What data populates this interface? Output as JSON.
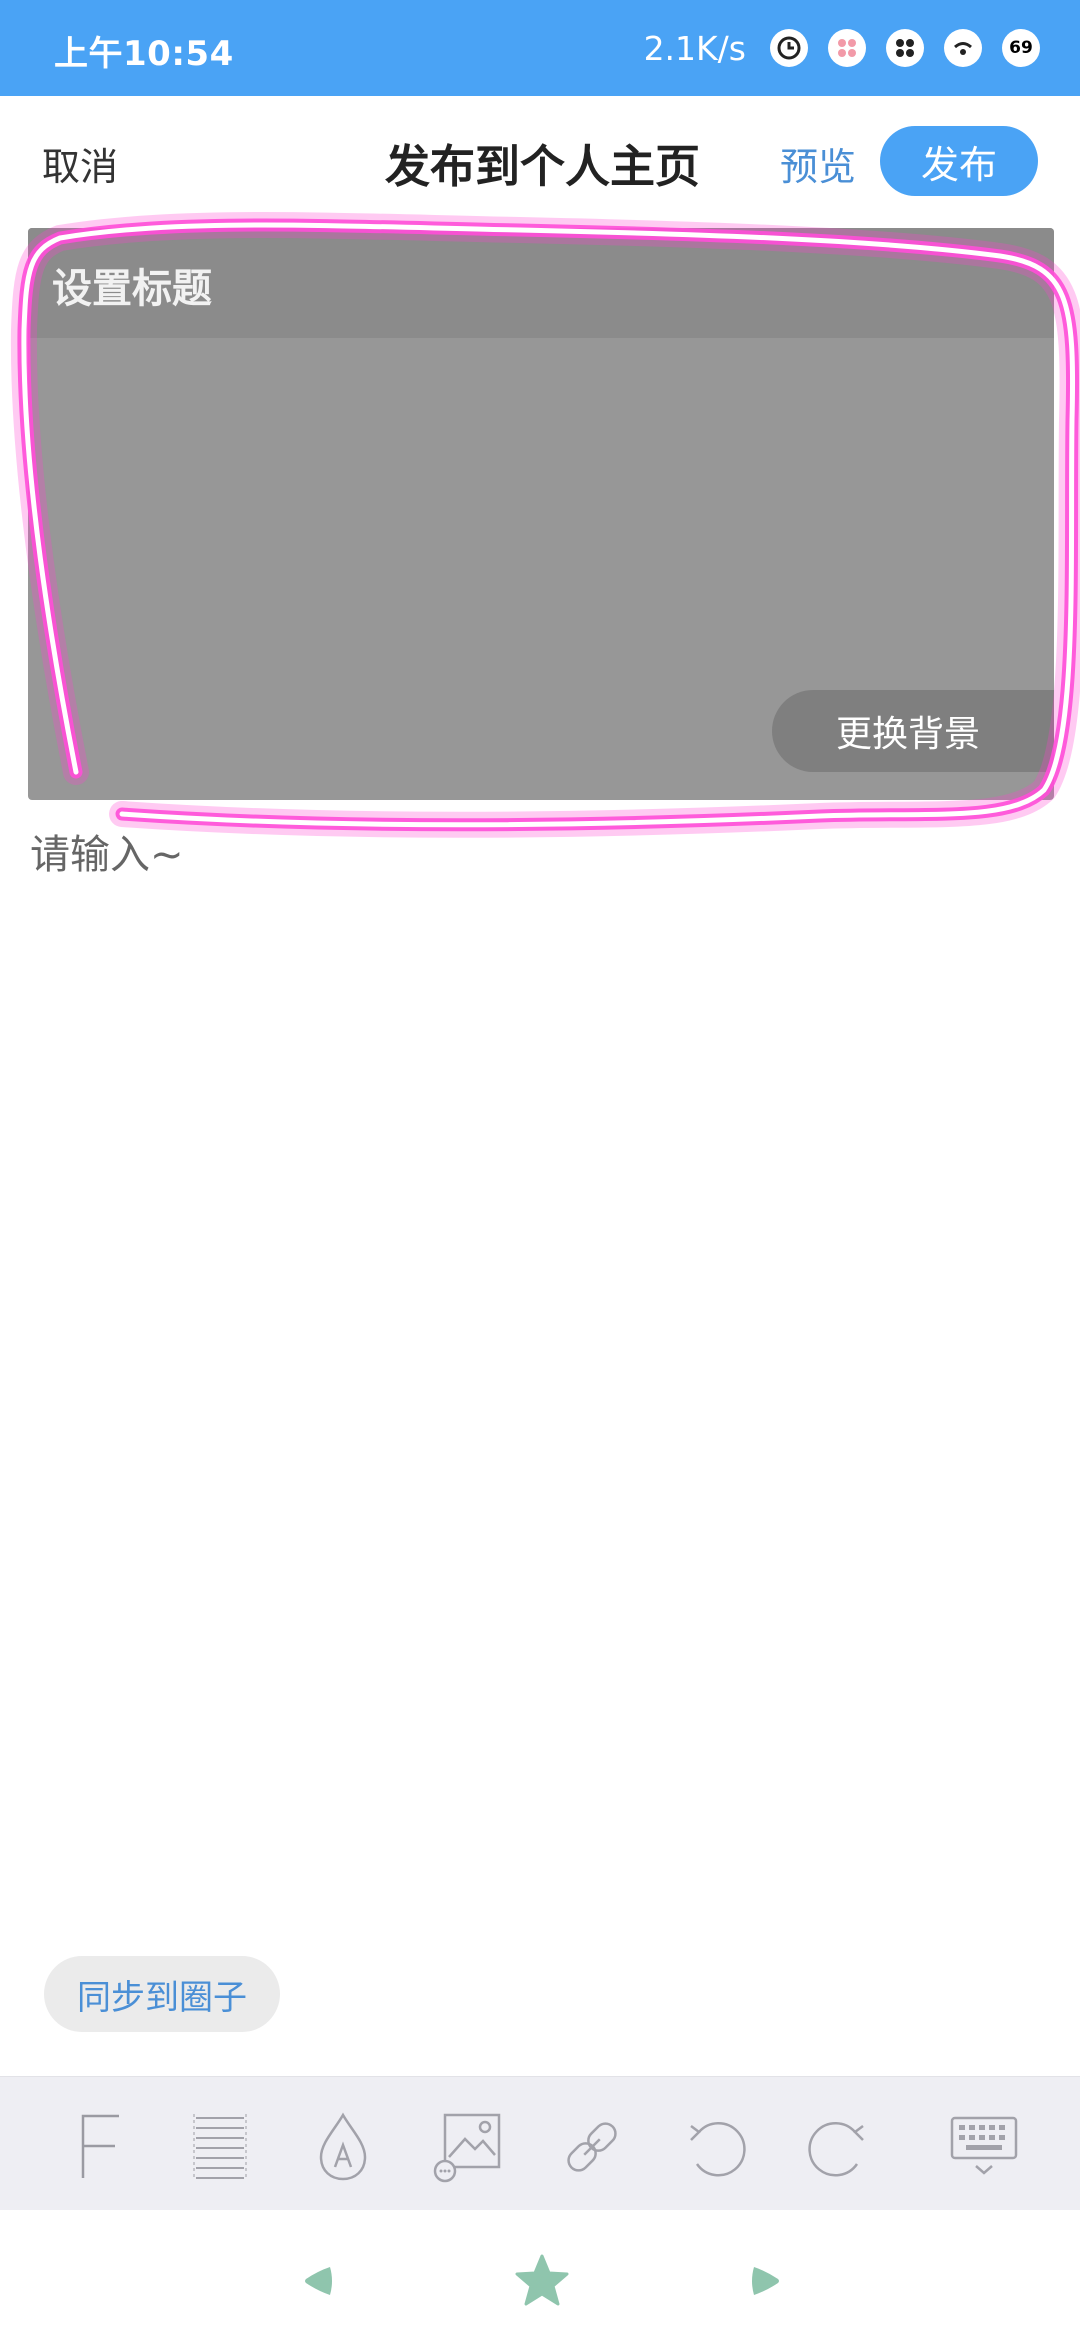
{
  "status_bar": {
    "time": "上午10:54",
    "net_speed": "2.1K/s",
    "battery": "69",
    "icons": [
      "alarm-clock-icon",
      "app-notification-icon",
      "app-grid-icon",
      "wifi-icon",
      "battery-icon"
    ]
  },
  "header": {
    "cancel_label": "取消",
    "title": "发布到个人主页",
    "preview_label": "预览",
    "publish_label": "发布"
  },
  "cover": {
    "title_placeholder": "设置标题",
    "change_bg_label": "更换背景"
  },
  "editor": {
    "placeholder": "请输入~"
  },
  "sync": {
    "label": "同步到圈子"
  },
  "toolbar": {
    "tools": [
      "font-style-icon",
      "paragraph-icon",
      "text-color-icon",
      "insert-image-icon",
      "link-icon",
      "undo-icon",
      "redo-icon",
      "hide-keyboard-icon"
    ]
  },
  "navbar": {
    "buttons": [
      "back-icon",
      "home-icon",
      "recents-icon"
    ]
  },
  "colors": {
    "accent": "#4aa3f5",
    "link": "#4a8fd6",
    "highlight": "#ff3fd2"
  }
}
